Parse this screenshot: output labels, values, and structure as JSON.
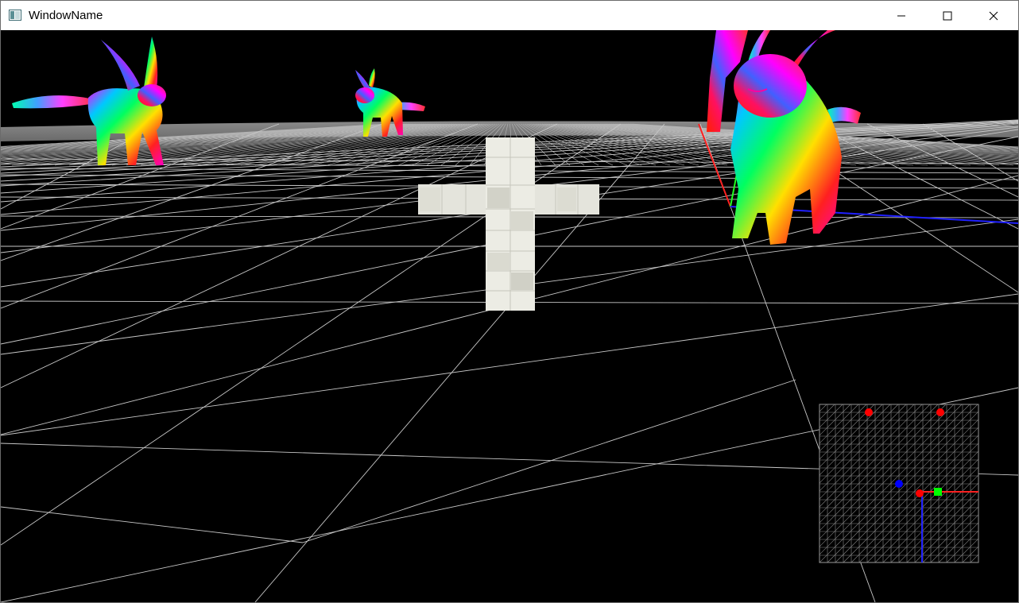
{
  "window": {
    "title": "WindowName"
  },
  "controls": {
    "minimize_icon": "minimize-icon",
    "maximize_icon": "maximize-icon",
    "close_icon": "close-icon"
  },
  "scene": {
    "background": "#000000",
    "grid_color": "#c8c8c8",
    "axis_x_color": "#ff2020",
    "axis_y_color": "#20ff20",
    "axis_z_color": "#2020ff",
    "models": [
      "rainbow-fox-model-left",
      "rainbow-fox-model-far",
      "rainbow-fox-model-right",
      "white-voxel-cross-model"
    ]
  },
  "minimap": {
    "grid_color": "#9a9a9a",
    "marker_colors": [
      "#ff0000",
      "#ff0000",
      "#0000ff",
      "#ff0000",
      "#00ff00"
    ]
  }
}
